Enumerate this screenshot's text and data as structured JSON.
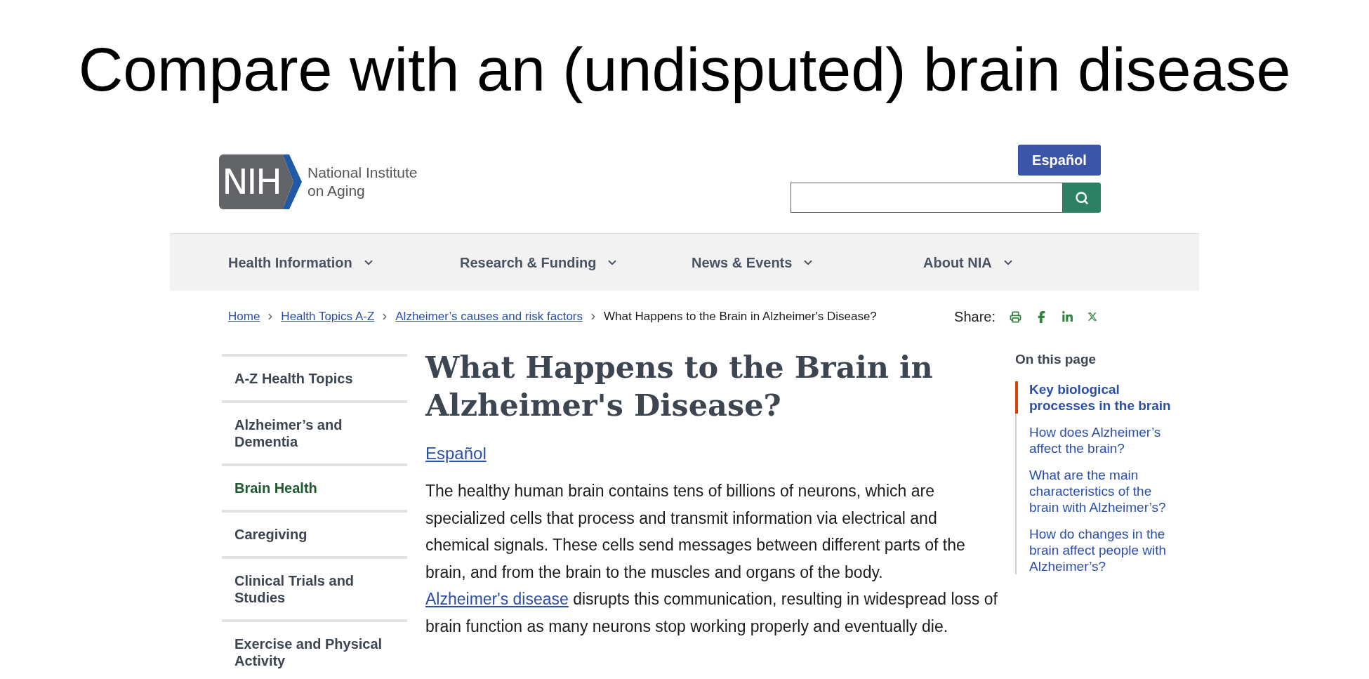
{
  "slide_title": "Compare with an (undisputed) brain disease",
  "header": {
    "logo_mark": "NIH",
    "logo_text": [
      "National Institute",
      "on Aging"
    ],
    "language_button": "Español"
  },
  "nav": [
    {
      "label": "Health Information"
    },
    {
      "label": "Research & Funding"
    },
    {
      "label": "News & Events"
    },
    {
      "label": "About NIA"
    }
  ],
  "breadcrumb": [
    {
      "label": "Home",
      "kind": "link"
    },
    {
      "label": "Health Topics A-Z",
      "kind": "link"
    },
    {
      "label": "Alzheimer’s causes and risk factors",
      "kind": "link"
    },
    {
      "label": "What Happens to the Brain in Alzheimer's Disease?",
      "kind": "current"
    }
  ],
  "share": {
    "label": "Share:",
    "icons": [
      {
        "kind": "print"
      },
      {
        "kind": "facebook"
      },
      {
        "kind": "linkedin"
      },
      {
        "kind": "x"
      }
    ]
  },
  "sidebar": [
    {
      "label": "A-Z Health Topics",
      "selected": false
    },
    {
      "label": "Alzheimer’s and Dementia",
      "selected": false
    },
    {
      "label": "Brain Health",
      "selected": true
    },
    {
      "label": "Caregiving",
      "selected": false
    },
    {
      "label": "Clinical Trials and Studies",
      "selected": false
    },
    {
      "label": "Exercise and Physical Activity",
      "selected": false
    }
  ],
  "article": {
    "title": "What Happens to the Brain in Alzheimer's Disease?",
    "language_link": "Español",
    "paragraph": [
      {
        "kind": "text",
        "text": "The healthy human brain contains tens of billions of neurons, which are specialized cells that process and transmit information via electrical and chemical signals. These cells send messages between different parts of the brain, and from the brain to the muscles and organs of the body. "
      },
      {
        "kind": "link",
        "text": "Alzheimer's disease"
      },
      {
        "kind": "text",
        "text": " disrupts this communication, resulting in widespread loss of brain function as many neurons stop working properly and eventually die."
      }
    ]
  },
  "on_this_page": {
    "title": "On this page",
    "items": [
      {
        "label": "Key biological processes in the brain",
        "selected": true
      },
      {
        "label": "How does Alzheimer’s affect the brain?",
        "selected": false
      },
      {
        "label": "What are the main characteristics of the brain with Alzheimer’s?",
        "selected": false
      },
      {
        "label": "How do changes in the brain affect people with Alzheimer’s?",
        "selected": false
      }
    ]
  }
}
